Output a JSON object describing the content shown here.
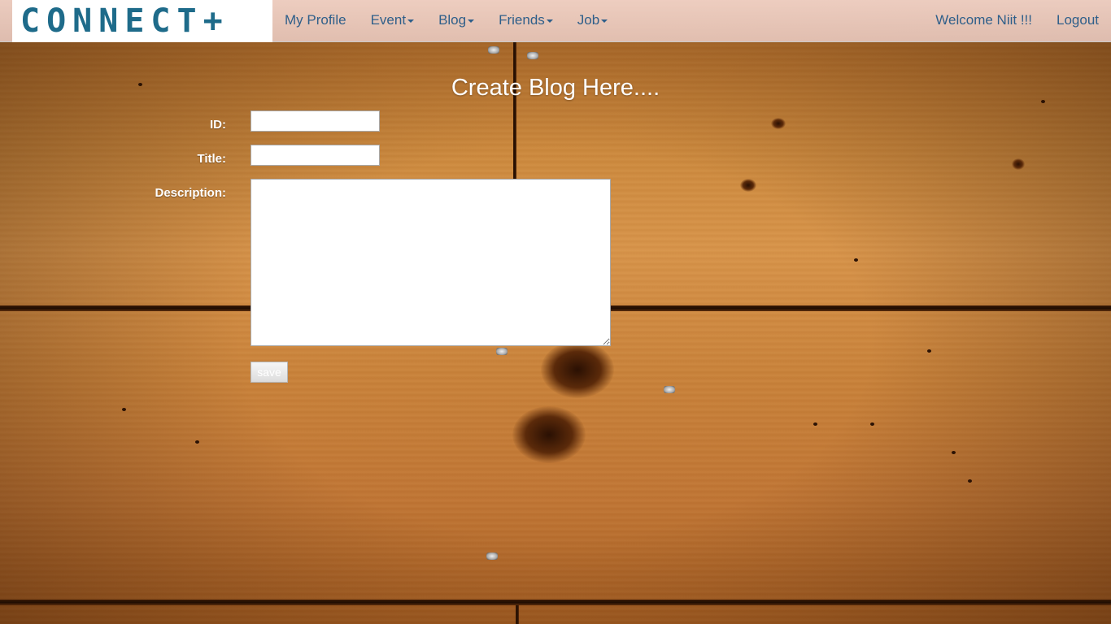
{
  "brand": {
    "logo_text": "CONNECT+"
  },
  "nav": {
    "left": [
      {
        "label": "My Profile",
        "dropdown": false
      },
      {
        "label": "Event",
        "dropdown": true
      },
      {
        "label": "Blog",
        "dropdown": true
      },
      {
        "label": "Friends",
        "dropdown": true
      },
      {
        "label": "Job",
        "dropdown": true
      }
    ],
    "welcome": "Welcome Niit !!!",
    "logout": "Logout"
  },
  "form": {
    "heading": "Create Blog Here....",
    "id_label": "ID:",
    "id_value": "",
    "title_label": "Title:",
    "title_value": "",
    "description_label": "Description:",
    "description_value": "",
    "save_label": "save"
  },
  "colors": {
    "nav_link": "#2f5f8a",
    "brand": "#1e6b8a",
    "background": "#c9823a"
  }
}
